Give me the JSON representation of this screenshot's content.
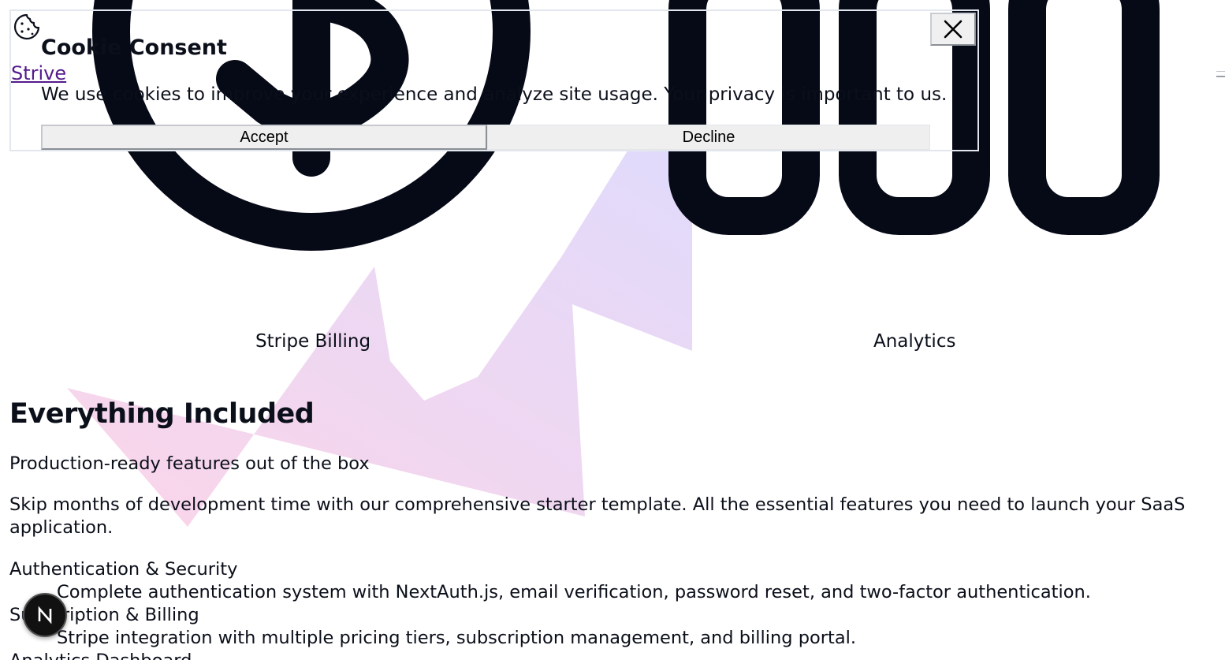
{
  "cookie_consent": {
    "title": "Cookie Consent",
    "message": "We use cookies to improve your experience and analyze site usage. Your privacy is important to us.",
    "accept_label": "Accept",
    "decline_label": "Decline",
    "close_icon": "close-icon",
    "cookie_icon": "cookie-icon"
  },
  "brand": {
    "name": "Strive"
  },
  "feature_cards": [
    {
      "icon": "dollar-icon",
      "label": "Stripe Billing"
    },
    {
      "icon": "analytics-icon",
      "label": "Analytics"
    }
  ],
  "everything_section": {
    "heading": "Everything Included",
    "subtitle": "Production-ready features out of the box",
    "description": "Skip months of development time with our comprehensive starter template. All the essential features you need to launch your SaaS application.",
    "features": [
      {
        "title": "Authentication & Security",
        "description": "Complete authentication system with NextAuth.js, email verification, password reset, and two-factor authentication."
      },
      {
        "title": "Subscription & Billing",
        "description": "Stripe integration with multiple pricing tiers, subscription management, and billing portal."
      },
      {
        "title": "Analytics Dashboard",
        "description": ""
      }
    ]
  },
  "dev_badge": {
    "letter": "N"
  },
  "colors": {
    "text": "#0b0f1a",
    "link": "#551a8b",
    "shard_pink": "#f7c6df",
    "shard_lavender": "#dcd2fa"
  }
}
